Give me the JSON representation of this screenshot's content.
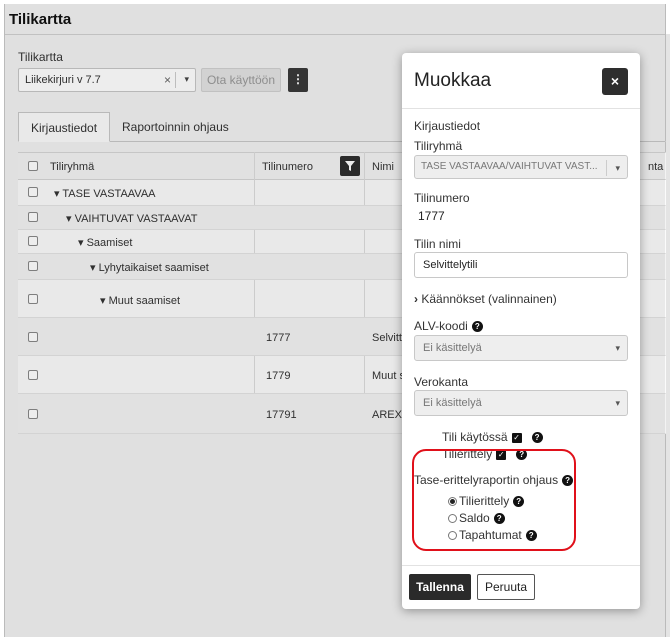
{
  "page": {
    "title": "Tilikartta"
  },
  "chart_account": {
    "label": "Tilikartta",
    "selected": "Liikekirjuri v 7.7",
    "clear_glyph": "×",
    "caret_glyph": "▾",
    "activate_label": "Ota käyttöön",
    "kebab_glyph": "⋮"
  },
  "tabs": [
    {
      "label": "Kirjaustiedot",
      "active": true
    },
    {
      "label": "Raportoinnin ohjaus",
      "active": false
    }
  ],
  "grid": {
    "columns": [
      "Tiliryhmä",
      "Tilinumero",
      "Nimi",
      "nta"
    ],
    "rows": [
      {
        "group": "▾ TASE VASTAAVAA",
        "number": "",
        "name": ""
      },
      {
        "group": "▾ VAIHTUVAT VASTAAVAT",
        "number": "",
        "name": ""
      },
      {
        "group": "▾ Saamiset",
        "number": "",
        "name": ""
      },
      {
        "group": "▾ Lyhytaikaiset saamiset",
        "number": "",
        "name": ""
      },
      {
        "group": "▾ Muut saamiset",
        "number": "",
        "name": ""
      },
      {
        "group": "",
        "number": "1777",
        "name": "Selvitte"
      },
      {
        "group": "",
        "number": "1779",
        "name": "Muut sa"
      },
      {
        "group": "",
        "number": "17791",
        "name": "AREX ta"
      }
    ]
  },
  "modal": {
    "title": "Muokkaa",
    "close_glyph": "×",
    "section": "Kirjaustiedot",
    "group_label": "Tiliryhmä",
    "group_value": "TASE VASTAAVAA/VAIHTUVAT VAST...",
    "number_label": "Tilinumero",
    "number_value": "1777",
    "name_label": "Tilin nimi",
    "name_value": "Selvittelytili",
    "translations_label": "Käännökset (valinnainen)",
    "translations_chevron": "›",
    "vat_label": "ALV-koodi",
    "vat_value": "Ei käsittelyä",
    "tax_label": "Verokanta",
    "tax_value": "Ei käsittelyä",
    "account_active_label": "Tili käytössä",
    "itemization_label": "Tilierittely",
    "balance_report_label": "Tase-erittelyraportin ohjaus",
    "radio_options": [
      {
        "label": "Tilierittely",
        "selected": true
      },
      {
        "label": "Saldo",
        "selected": false
      },
      {
        "label": "Tapahtumat",
        "selected": false
      }
    ],
    "save_label": "Tallenna",
    "cancel_label": "Peruuta",
    "help_glyph": "?",
    "check_glyph": "✓"
  },
  "colors": {
    "highlight": "#e0101a",
    "dark_button": "#2a2a2a"
  }
}
